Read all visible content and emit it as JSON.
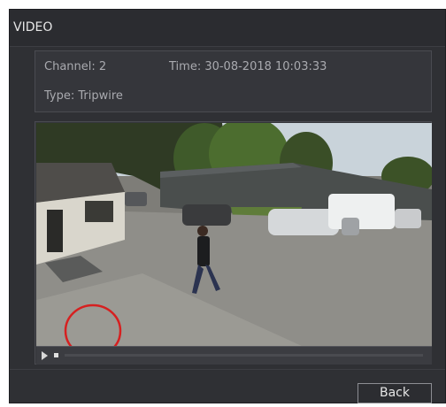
{
  "window": {
    "title": "VIDEO"
  },
  "event_info": {
    "channel": "Channel: 2",
    "time": "Time: 30-08-2018 10:03:33",
    "type": "Type: Tripwire"
  },
  "player": {
    "play_icon": "play-icon",
    "stop_icon": "stop-icon",
    "progress": 0
  },
  "annotation": {
    "color": "#d62020"
  },
  "footer": {
    "back_label": "Back"
  }
}
